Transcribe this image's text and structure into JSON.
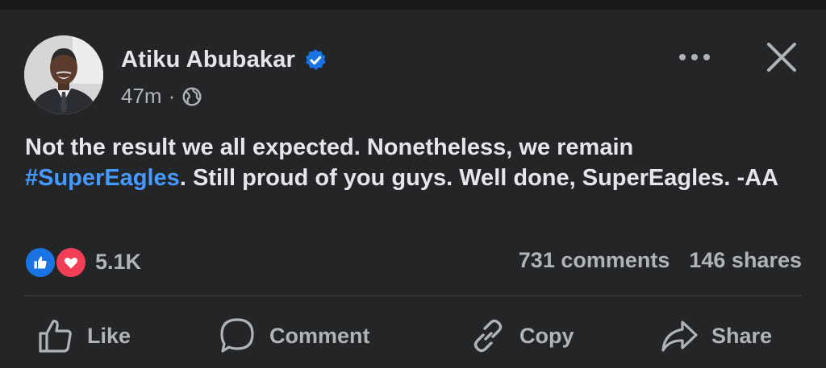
{
  "post": {
    "author": "Atiku Abubakar",
    "time": "47m",
    "separator": "·",
    "text_before": "Not the result we all expected. Nonetheless, we remain ",
    "hashtag": "#SuperEagles",
    "text_after": ". Still proud of you guys. Well done, SuperEagles. -AA"
  },
  "stats": {
    "reactions": "5.1K",
    "comments": "731 comments",
    "shares": "146 shares"
  },
  "actions": {
    "like": "Like",
    "comment": "Comment",
    "copy": "Copy",
    "share": "Share"
  },
  "icons": {
    "verified": "verified-badge-icon",
    "audience": "globe-icon",
    "more": "more-options-icon",
    "close": "close-icon",
    "like": "thumbs-up-icon",
    "comment": "speech-bubble-icon",
    "copy": "link-icon",
    "share": "share-arrow-icon"
  },
  "colors": {
    "background": "#242526",
    "text": "#e4e6eb",
    "muted": "#b0b3b8",
    "link": "#4599ff",
    "like_blue": "#1b74e4",
    "love_red": "#f33e58"
  }
}
